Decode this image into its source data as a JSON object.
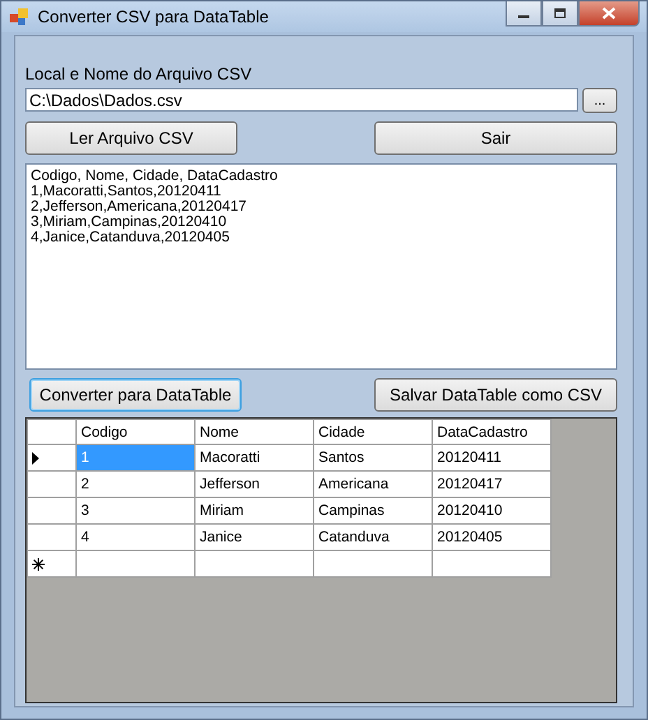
{
  "window": {
    "title": "Converter CSV para DataTable"
  },
  "file_label": "Local e Nome do Arquivo CSV",
  "file_field": {
    "value": "C:\\Dados\\Dados.csv"
  },
  "browse_button": "...",
  "top_buttons": [
    {
      "label": "Ler Arquivo CSV",
      "focused": false
    },
    {
      "label": "Sair",
      "focused": false
    }
  ],
  "text_area": {
    "lines": [
      "Codigo, Nome, Cidade, DataCadastro",
      "1,Macoratti,Santos,20120411",
      "2,Jefferson,Americana,20120417",
      "3,Miriam,Campinas,20120410",
      "4,Janice,Catanduva,20120405"
    ]
  },
  "bottom_buttons": [
    {
      "label": "Converter para DataTable",
      "focused": true
    },
    {
      "label": "Salvar DataTable como CSV",
      "focused": false
    }
  ],
  "grid": {
    "columns": [
      "Codigo",
      "Nome",
      "Cidade",
      "DataCadastro"
    ],
    "rows": [
      {
        "current": true,
        "cells": [
          {
            "text": "1",
            "selected": true
          },
          {
            "text": "Macoratti",
            "selected": false
          },
          {
            "text": "Santos",
            "selected": false
          },
          {
            "text": "20120411",
            "selected": false
          }
        ]
      },
      {
        "current": false,
        "cells": [
          {
            "text": "2",
            "selected": false
          },
          {
            "text": "Jefferson",
            "selected": false
          },
          {
            "text": "Americana",
            "selected": false
          },
          {
            "text": "20120417",
            "selected": false
          }
        ]
      },
      {
        "current": false,
        "cells": [
          {
            "text": "3",
            "selected": false
          },
          {
            "text": "Miriam",
            "selected": false
          },
          {
            "text": "Campinas",
            "selected": false
          },
          {
            "text": "20120410",
            "selected": false
          }
        ]
      },
      {
        "current": false,
        "cells": [
          {
            "text": "4",
            "selected": false
          },
          {
            "text": "Janice",
            "selected": false
          },
          {
            "text": "Catanduva",
            "selected": false
          },
          {
            "text": "20120405",
            "selected": false
          }
        ]
      }
    ],
    "new_row": true
  }
}
